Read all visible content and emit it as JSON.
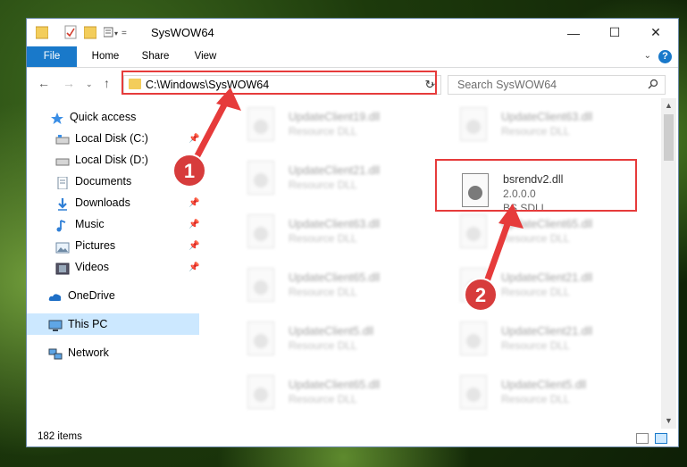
{
  "window": {
    "title": "SysWOW64",
    "controls": {
      "minimize": "—",
      "maximize": "☐",
      "close": "✕"
    }
  },
  "ribbon": {
    "tabs": [
      "File",
      "Home",
      "Share",
      "View"
    ],
    "help": "?"
  },
  "nav": {
    "address": "C:\\Windows\\SysWOW64",
    "search_placeholder": "Search SysWOW64"
  },
  "sidebar": {
    "quick_access": "Quick access",
    "items": [
      {
        "label": "Local Disk (C:)",
        "pinned": true
      },
      {
        "label": "Local Disk (D:)",
        "pinned": false
      },
      {
        "label": "Documents",
        "pinned": true
      },
      {
        "label": "Downloads",
        "pinned": true
      },
      {
        "label": "Music",
        "pinned": true
      },
      {
        "label": "Pictures",
        "pinned": true
      },
      {
        "label": "Videos",
        "pinned": true
      }
    ],
    "onedrive": "OneDrive",
    "this_pc": "This PC",
    "network": "Network"
  },
  "files": {
    "left": [
      {
        "name": "UpdateClient19.dll",
        "desc": "Resource DLL"
      },
      {
        "name": "UpdateClient21.dll",
        "desc": "Resource DLL"
      },
      {
        "name": "UpdateClient63.dll",
        "desc": "Resource DLL"
      },
      {
        "name": "UpdateClient65.dll",
        "desc": "Resource DLL"
      },
      {
        "name": "UpdateClient5.dll",
        "desc": "Resource DLL"
      },
      {
        "name": "UpdateClient65.dll",
        "desc": "Resource DLL"
      },
      {
        "name": "UpdateClient65.dll",
        "desc": "Resource DLL"
      }
    ],
    "right": [
      {
        "name": "UpdateClient63.dll",
        "desc": "Resource DLL"
      },
      {
        "name": "UpdateClient65.dll",
        "desc": "Resource DLL"
      },
      {
        "name": "UpdateClient21.dll",
        "desc": "Resource DLL"
      },
      {
        "name": "UpdateClient21.dll",
        "desc": "Resource DLL"
      },
      {
        "name": "UpdateClient5.dll",
        "desc": "Resource DLL"
      }
    ],
    "highlighted": {
      "name": "bsrendv2.dll",
      "version": "2.0.0.0",
      "desc": "BS SDLL"
    }
  },
  "status": {
    "count": "182 items"
  },
  "annotations": {
    "marker1": "1",
    "marker2": "2",
    "color": "#e63b3b"
  }
}
